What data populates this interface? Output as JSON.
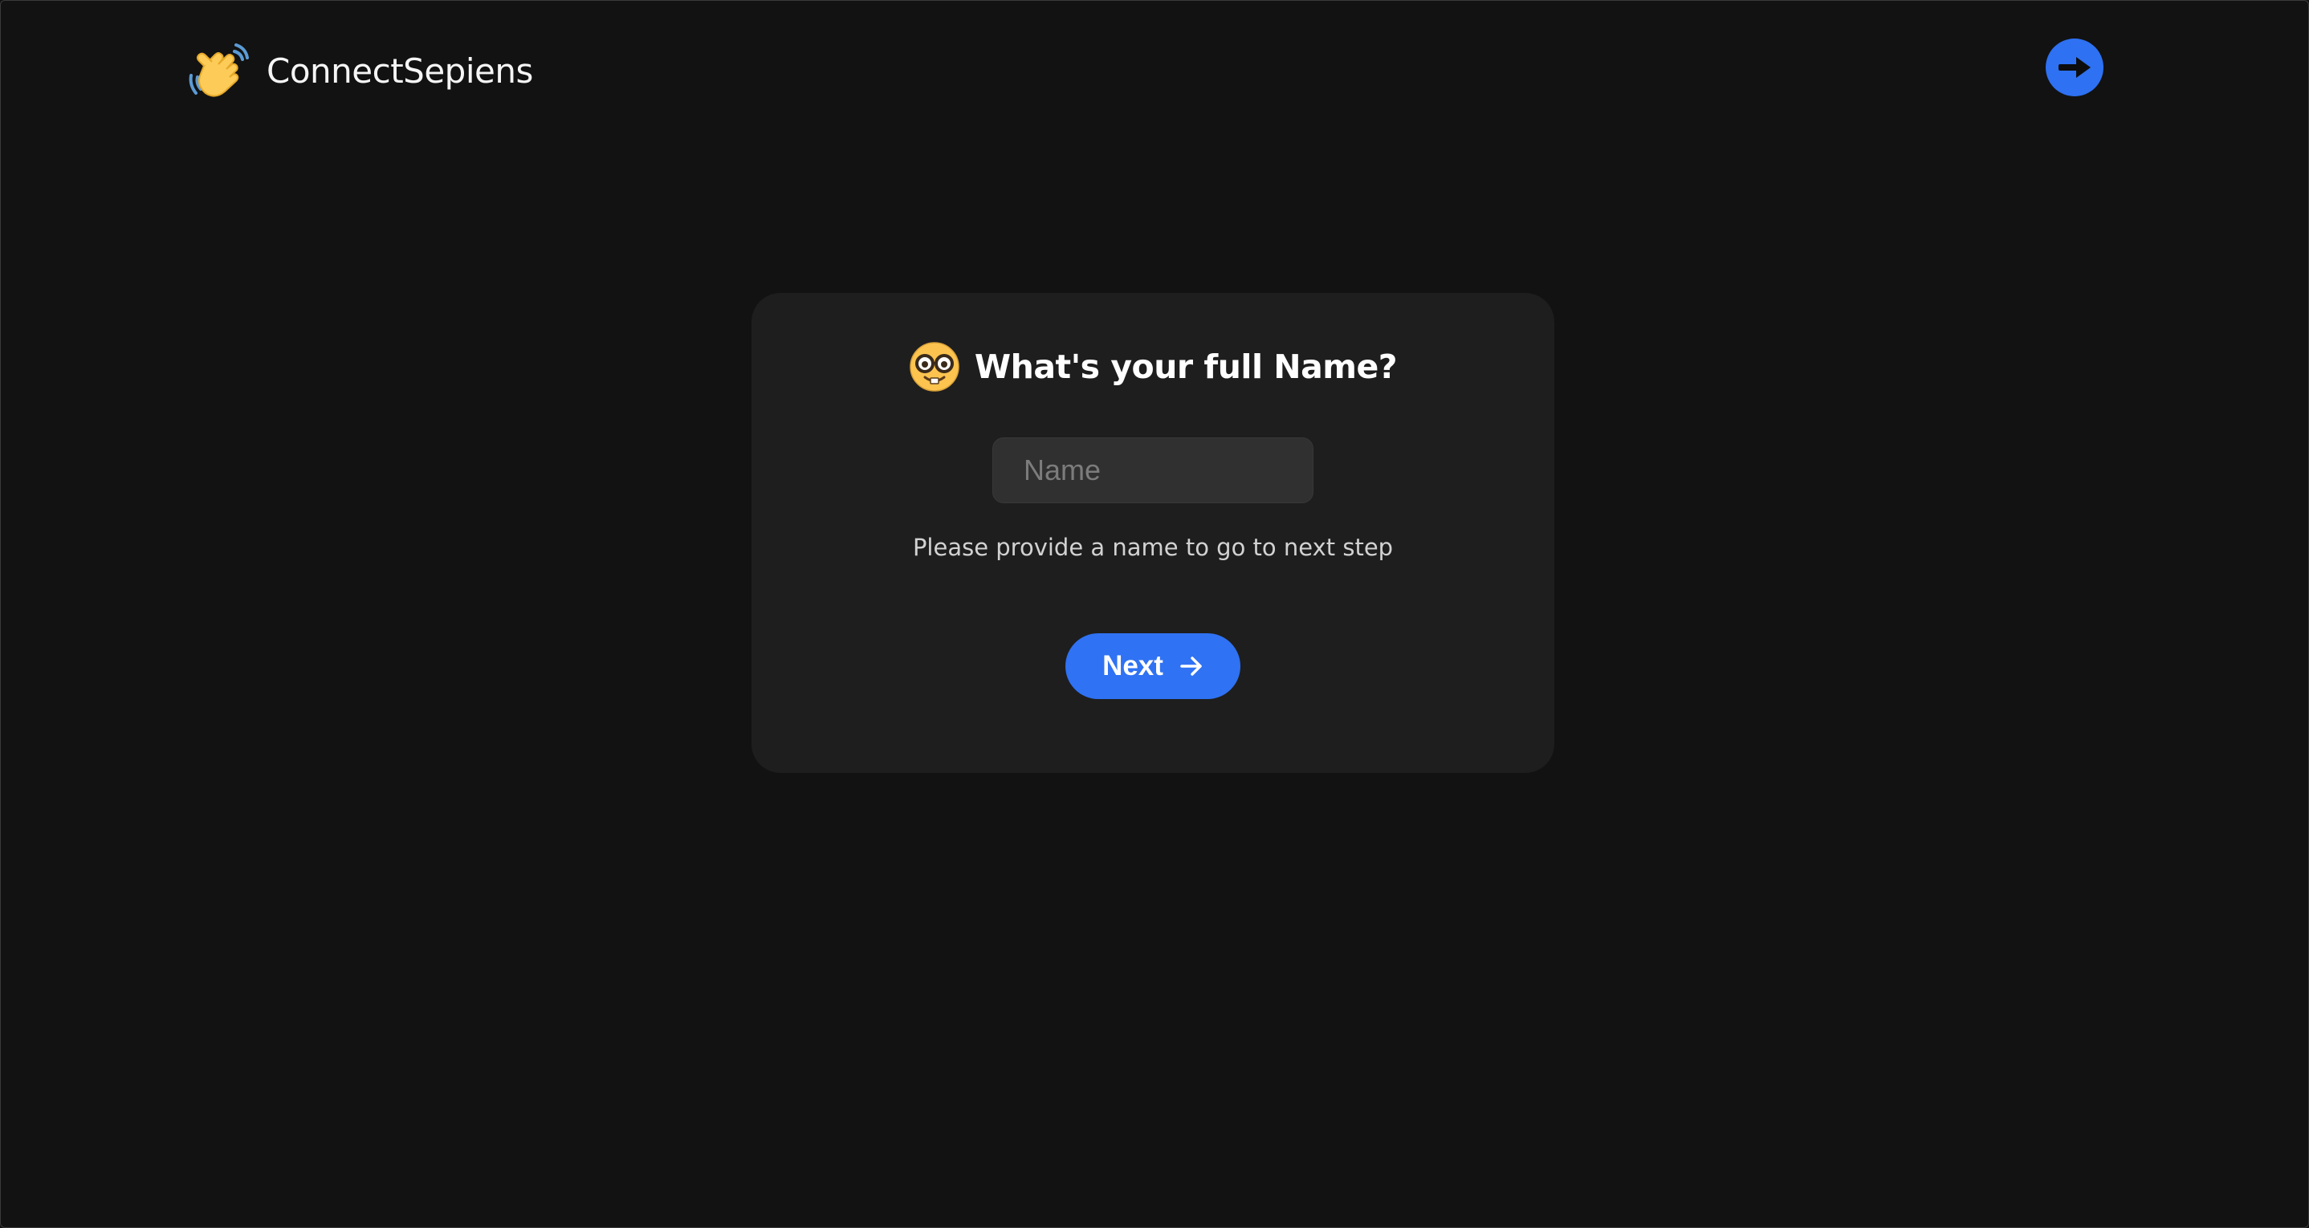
{
  "header": {
    "brand_name": "ConnectSepiens",
    "brand_icon": "waving-hand-emoji",
    "logout_icon": "arrow-right-icon"
  },
  "card": {
    "question_icon": "nerd-face-emoji",
    "question": "What's your full Name?",
    "name_input": {
      "value": "",
      "placeholder": "Name"
    },
    "hint": "Please provide a name to go to next step",
    "next_button": {
      "label": "Next",
      "icon": "arrow-right-icon"
    }
  },
  "colors": {
    "background": "#121212",
    "card": "#1e1e1e",
    "accent": "#2f72f3",
    "input": "#303030"
  }
}
